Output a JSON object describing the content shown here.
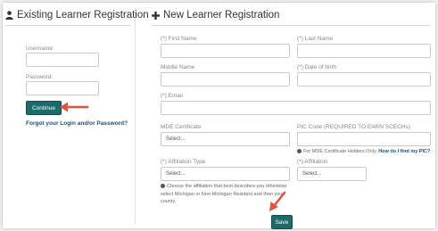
{
  "existing": {
    "title": "Existing Learner Registration",
    "username_label": "Username:",
    "username_value": "",
    "password_label": "Password:",
    "password_value": "",
    "continue_label": "Continue",
    "forgot_link": "Forgot your Login and/or Password?"
  },
  "new": {
    "title": "New Learner Registration",
    "first_name_label": "(*) First Name",
    "last_name_label": "(*) Last Name",
    "middle_name_label": "Middle Name",
    "dob_label": "(*) Date of birth",
    "email_label": "(*) Email",
    "mde_label": "MDE Certificate",
    "mde_placeholder": "Select...",
    "pic_label": "PIC Code (REQUIRED TO EARN SCECHs)",
    "pic_note": "For MDE Certificate Holders Only.",
    "pic_link": "How do I find my PIC?",
    "aff_type_label": "(*) Affiliation Type",
    "aff_type_placeholder": "Select...",
    "aff_label": "(*) Affiliation",
    "aff_placeholder": "Select...",
    "aff_note": "Choose the affiliation that best describes you otherwise select Michigan or Non-Michigan Resident and then your county.",
    "save_label": "Save"
  },
  "colors": {
    "accent": "#1b6b6b",
    "arrow": "#e0533f",
    "link": "#1b4f7a"
  }
}
